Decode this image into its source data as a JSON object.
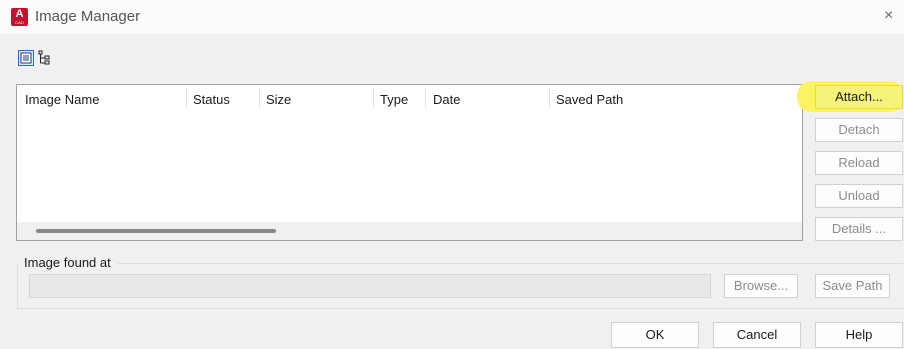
{
  "window": {
    "title": "Image Manager",
    "app_icon_letter": "A",
    "app_icon_sub": "CAD",
    "close_glyph": "×"
  },
  "view_toggles": [
    {
      "icon": "list-view-icon",
      "selected": true
    },
    {
      "icon": "tree-view-icon",
      "selected": false
    }
  ],
  "table": {
    "columns": [
      "Image Name",
      "Status",
      "Size",
      "Type",
      "Date",
      "Saved Path"
    ],
    "rows": []
  },
  "side_buttons": {
    "attach": {
      "label": "Attach...",
      "enabled": true
    },
    "detach": {
      "label": "Detach",
      "enabled": false
    },
    "reload": {
      "label": "Reload",
      "enabled": false
    },
    "unload": {
      "label": "Unload",
      "enabled": false
    },
    "details": {
      "label": "Details ...",
      "enabled": false
    }
  },
  "image_found_at": {
    "label": "Image found at",
    "path_value": "",
    "browse_label": "Browse...",
    "save_path_label": "Save Path"
  },
  "footer": {
    "ok_label": "OK",
    "cancel_label": "Cancel",
    "help_label": "Help"
  },
  "colors": {
    "highlight": "#fbf460",
    "app_icon": "#c8102e"
  }
}
